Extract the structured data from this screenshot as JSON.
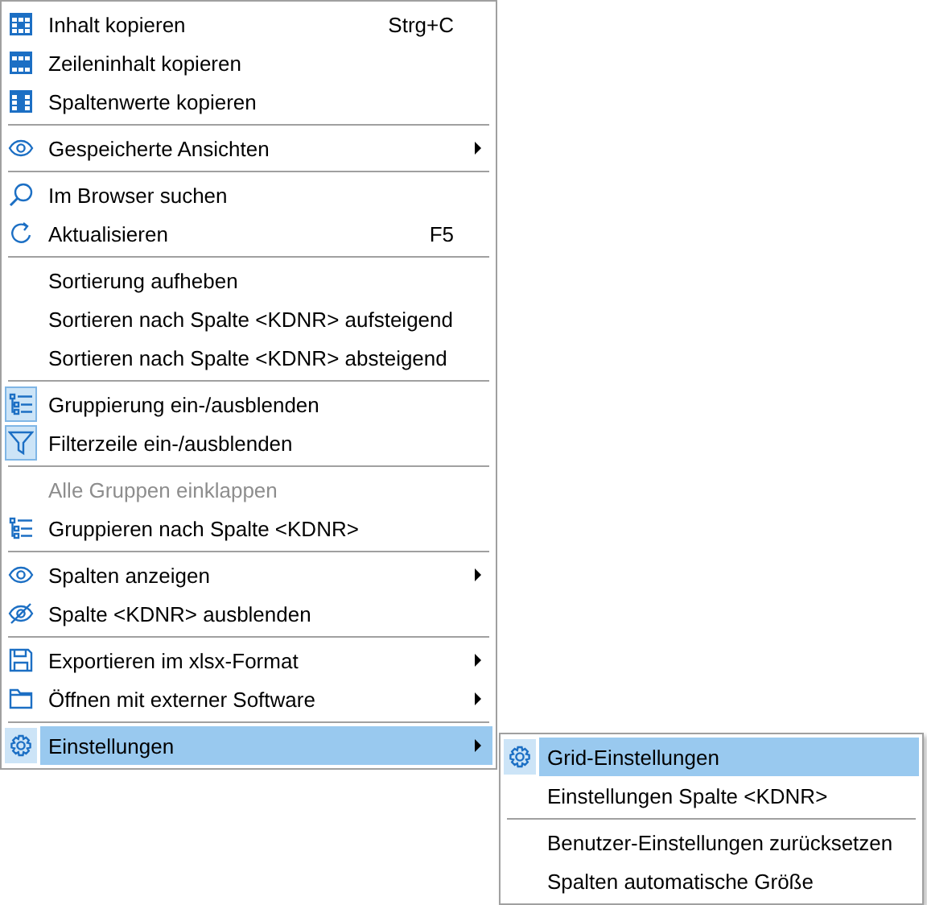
{
  "context_menu": {
    "sections": [
      [
        {
          "label": "Inhalt kopieren",
          "shortcut": "Strg+C",
          "has_submenu": false,
          "checked": false,
          "disabled": false,
          "selected": false
        },
        {
          "label": "Zeileninhalt kopieren",
          "has_submenu": false,
          "checked": false,
          "disabled": false,
          "selected": false
        },
        {
          "label": "Spaltenwerte kopieren",
          "has_submenu": false,
          "checked": false,
          "disabled": false,
          "selected": false
        }
      ],
      [
        {
          "label": "Gespeicherte Ansichten",
          "has_submenu": true,
          "checked": false,
          "disabled": false,
          "selected": false
        }
      ],
      [
        {
          "label": "Im Browser suchen",
          "has_submenu": false,
          "checked": false,
          "disabled": false,
          "selected": false
        },
        {
          "label": "Aktualisieren",
          "shortcut": "F5",
          "has_submenu": false,
          "checked": false,
          "disabled": false,
          "selected": false
        }
      ],
      [
        {
          "label": "Sortierung aufheben",
          "has_submenu": false,
          "checked": false,
          "disabled": false,
          "selected": false
        },
        {
          "label": "Sortieren nach Spalte <KDNR> aufsteigend",
          "has_submenu": false,
          "checked": false,
          "disabled": false,
          "selected": false
        },
        {
          "label": "Sortieren nach Spalte <KDNR> absteigend",
          "has_submenu": false,
          "checked": false,
          "disabled": false,
          "selected": false
        }
      ],
      [
        {
          "label": "Gruppierung ein-/ausblenden",
          "has_submenu": false,
          "checked": true,
          "disabled": false,
          "selected": false
        },
        {
          "label": "Filterzeile ein-/ausblenden",
          "has_submenu": false,
          "checked": true,
          "disabled": false,
          "selected": false
        }
      ],
      [
        {
          "label": "Alle Gruppen einklappen",
          "has_submenu": false,
          "checked": false,
          "disabled": true,
          "selected": false
        },
        {
          "label": "Gruppieren nach Spalte <KDNR>",
          "has_submenu": false,
          "checked": false,
          "disabled": false,
          "selected": false
        }
      ],
      [
        {
          "label": "Spalten anzeigen",
          "has_submenu": true,
          "checked": false,
          "disabled": false,
          "selected": false
        },
        {
          "label": "Spalte <KDNR> ausblenden",
          "has_submenu": false,
          "checked": false,
          "disabled": false,
          "selected": false
        }
      ],
      [
        {
          "label": "Exportieren im xlsx-Format",
          "has_submenu": true,
          "checked": false,
          "disabled": false,
          "selected": false
        },
        {
          "label": "Öffnen mit externer Software",
          "has_submenu": true,
          "checked": false,
          "disabled": false,
          "selected": false
        }
      ],
      [
        {
          "label": "Einstellungen",
          "has_submenu": true,
          "checked": false,
          "disabled": false,
          "selected": true
        }
      ]
    ]
  },
  "submenu": {
    "sections": [
      [
        {
          "label": "Grid-Einstellungen",
          "has_submenu": false,
          "checked": false,
          "disabled": false,
          "selected": true
        },
        {
          "label": "Einstellungen Spalte <KDNR>",
          "has_submenu": false,
          "checked": false,
          "disabled": false,
          "selected": false
        }
      ],
      [
        {
          "label": "Benutzer-Einstellungen zurücksetzen",
          "has_submenu": false,
          "checked": false,
          "disabled": false,
          "selected": false
        },
        {
          "label": "Spalten automatische Größe",
          "has_submenu": false,
          "checked": false,
          "disabled": false,
          "selected": false
        }
      ]
    ]
  }
}
